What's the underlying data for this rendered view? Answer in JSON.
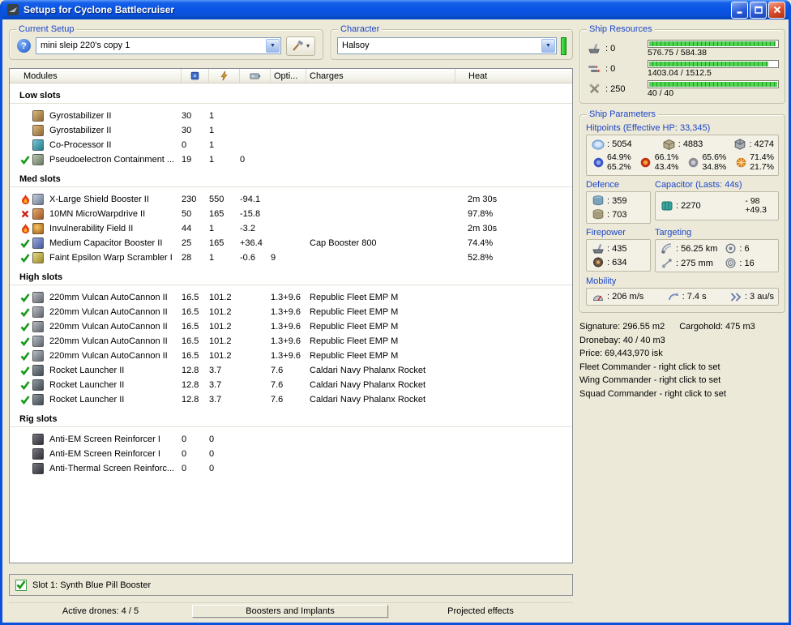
{
  "window": {
    "title": "Setups for Cyclone Battlecruiser"
  },
  "setup": {
    "group_label": "Current Setup",
    "value": "mini sleip 220's copy 1"
  },
  "character": {
    "group_label": "Character",
    "value": "Halsoy"
  },
  "table": {
    "headers": {
      "modules": "Modules",
      "opti": "Opti...",
      "charges": "Charges",
      "heat": "Heat"
    },
    "sections": [
      {
        "title": "Low slots",
        "rows": [
          {
            "status": "",
            "icon": "gyrostabilizer",
            "name": "Gyrostabilizer II",
            "cpu": "30",
            "pg": "1",
            "cap": "",
            "opti": "",
            "charge": "",
            "heat": ""
          },
          {
            "status": "",
            "icon": "gyrostabilizer",
            "name": "Gyrostabilizer II",
            "cpu": "30",
            "pg": "1",
            "cap": "",
            "opti": "",
            "charge": "",
            "heat": ""
          },
          {
            "status": "",
            "icon": "coprocessor",
            "name": "Co-Processor II",
            "cpu": "0",
            "pg": "1",
            "cap": "",
            "opti": "",
            "charge": "",
            "heat": ""
          },
          {
            "status": "check",
            "icon": "pseudoelectron",
            "name": "Pseudoelectron Containment ...",
            "cpu": "19",
            "pg": "1",
            "cap": "0",
            "opti": "",
            "charge": "",
            "heat": ""
          }
        ]
      },
      {
        "title": "Med slots",
        "rows": [
          {
            "status": "flame",
            "icon": "shield-booster",
            "name": "X-Large Shield Booster II",
            "cpu": "230",
            "pg": "550",
            "cap": "-94.1",
            "opti": "",
            "charge": "",
            "heat": "2m 30s"
          },
          {
            "status": "cross",
            "icon": "mwd",
            "name": "10MN MicroWarpdrive II",
            "cpu": "50",
            "pg": "165",
            "cap": "-15.8",
            "opti": "",
            "charge": "",
            "heat": "97.8%"
          },
          {
            "status": "flame",
            "icon": "invuln",
            "name": "Invulnerability Field II",
            "cpu": "44",
            "pg": "1",
            "cap": "-3.2",
            "opti": "",
            "charge": "",
            "heat": "2m 30s"
          },
          {
            "status": "check",
            "icon": "cap-booster",
            "name": "Medium Capacitor Booster II",
            "cpu": "25",
            "pg": "165",
            "cap": "+36.4",
            "opti": "",
            "charge": "Cap Booster 800",
            "heat": "74.4%"
          },
          {
            "status": "check",
            "icon": "scrambler",
            "name": "Faint Epsilon Warp Scrambler I",
            "cpu": "28",
            "pg": "1",
            "cap": "-0.6",
            "opti": "9",
            "charge": "",
            "heat": "52.8%"
          }
        ]
      },
      {
        "title": "High slots",
        "rows": [
          {
            "status": "check",
            "icon": "autocannon",
            "name": "220mm Vulcan AutoCannon II",
            "cpu": "16.5",
            "pg": "101.2",
            "cap": "",
            "opti": "1.3+9.6",
            "charge": "Republic Fleet EMP M",
            "heat": ""
          },
          {
            "status": "check",
            "icon": "autocannon",
            "name": "220mm Vulcan AutoCannon II",
            "cpu": "16.5",
            "pg": "101.2",
            "cap": "",
            "opti": "1.3+9.6",
            "charge": "Republic Fleet EMP M",
            "heat": ""
          },
          {
            "status": "check",
            "icon": "autocannon",
            "name": "220mm Vulcan AutoCannon II",
            "cpu": "16.5",
            "pg": "101.2",
            "cap": "",
            "opti": "1.3+9.6",
            "charge": "Republic Fleet EMP M",
            "heat": ""
          },
          {
            "status": "check",
            "icon": "autocannon",
            "name": "220mm Vulcan AutoCannon II",
            "cpu": "16.5",
            "pg": "101.2",
            "cap": "",
            "opti": "1.3+9.6",
            "charge": "Republic Fleet EMP M",
            "heat": ""
          },
          {
            "status": "check",
            "icon": "autocannon",
            "name": "220mm Vulcan AutoCannon II",
            "cpu": "16.5",
            "pg": "101.2",
            "cap": "",
            "opti": "1.3+9.6",
            "charge": "Republic Fleet EMP M",
            "heat": ""
          },
          {
            "status": "check",
            "icon": "rocket",
            "name": "Rocket Launcher II",
            "cpu": "12.8",
            "pg": "3.7",
            "cap": "",
            "opti": "7.6",
            "charge": "Caldari Navy Phalanx Rocket",
            "heat": ""
          },
          {
            "status": "check",
            "icon": "rocket",
            "name": "Rocket Launcher II",
            "cpu": "12.8",
            "pg": "3.7",
            "cap": "",
            "opti": "7.6",
            "charge": "Caldari Navy Phalanx Rocket",
            "heat": ""
          },
          {
            "status": "check",
            "icon": "rocket",
            "name": "Rocket Launcher II",
            "cpu": "12.8",
            "pg": "3.7",
            "cap": "",
            "opti": "7.6",
            "charge": "Caldari Navy Phalanx Rocket",
            "heat": ""
          }
        ]
      },
      {
        "title": "Rig slots",
        "rows": [
          {
            "status": "",
            "icon": "rig",
            "name": "Anti-EM Screen Reinforcer I",
            "cpu": "0",
            "pg": "0",
            "cap": "",
            "opti": "",
            "charge": "",
            "heat": ""
          },
          {
            "status": "",
            "icon": "rig",
            "name": "Anti-EM Screen Reinforcer I",
            "cpu": "0",
            "pg": "0",
            "cap": "",
            "opti": "",
            "charge": "",
            "heat": ""
          },
          {
            "status": "",
            "icon": "rig",
            "name": "Anti-Thermal Screen Reinforc...",
            "cpu": "0",
            "pg": "0",
            "cap": "",
            "opti": "",
            "charge": "",
            "heat": ""
          }
        ]
      }
    ]
  },
  "booster": {
    "label": "Slot 1: Synth Blue Pill Booster",
    "checked": true
  },
  "status_bar": {
    "active_drones": "Active drones: 4 / 5",
    "boosters_button": "Boosters and Implants",
    "projected": "Projected effects"
  },
  "resources": {
    "group_label": "Ship Resources",
    "turrets": "0",
    "launchers": "0",
    "calibration": "250",
    "cpu_text": "576.75 / 584.38",
    "pg_text": "1403.04 / 1512.5",
    "drone_text": "40 / 40",
    "cpu_pct": 99,
    "pg_pct": 93,
    "drone_pct": 100
  },
  "parameters": {
    "group_label": "Ship Parameters",
    "hitpoints_label": "Hitpoints (Effective HP: 33,345)",
    "shield_hp": "5054",
    "armor_hp": "4883",
    "hull_hp": "4274",
    "resists": [
      {
        "top": "64.9%",
        "bottom": "65.2%"
      },
      {
        "top": "66.1%",
        "bottom": "43.4%"
      },
      {
        "top": "65.6%",
        "bottom": "34.8%"
      },
      {
        "top": "71.4%",
        "bottom": "21.7%"
      }
    ],
    "defence": {
      "label": "Defence",
      "tank": "359",
      "reinforced": "703"
    },
    "capacitor": {
      "label": "Capacitor (Lasts: 44s)",
      "amount": "2270",
      "drain": "- 98",
      "peak": "+49.3"
    },
    "firepower": {
      "label": "Firepower",
      "dps": "435",
      "volley": "634"
    },
    "targeting": {
      "label": "Targeting",
      "range": "56.25 km",
      "max_targets": "6",
      "scan_res": "275 mm",
      "sensor_strength": "16"
    },
    "mobility": {
      "label": "Mobility",
      "speed": "206 m/s",
      "align": "7.4 s",
      "warp": "3 au/s"
    }
  },
  "info": {
    "signature": "Signature: 296.55 m2",
    "cargohold": "Cargohold: 475 m3",
    "dronebay": "Dronebay: 40 / 40 m3",
    "price": "Price: 69,443,970 isk",
    "fleet": "Fleet Commander - right click to set",
    "wing": "Wing Commander - right click to set",
    "squad": "Squad Commander - right click to set"
  }
}
